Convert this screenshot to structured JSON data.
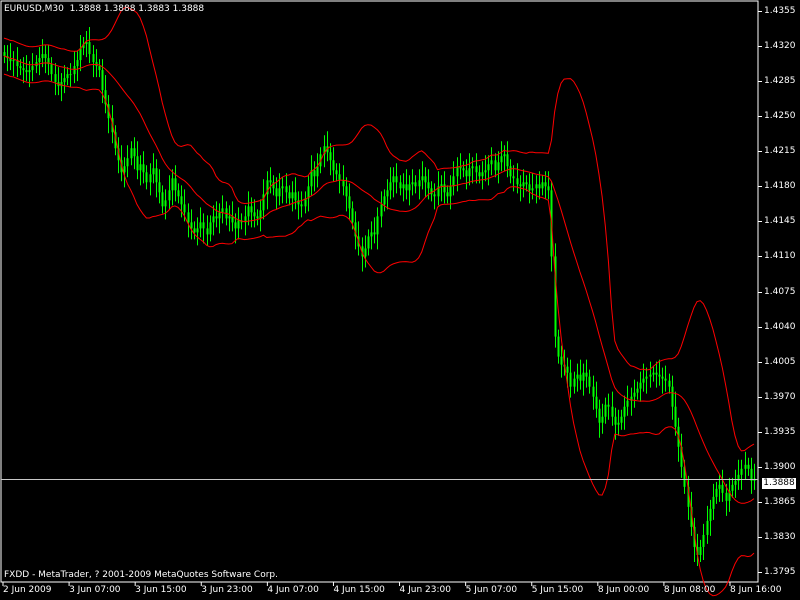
{
  "header": {
    "symbol": "EURUSD,M30",
    "ohlc": "1.3888 1.3888 1.3883 1.3888"
  },
  "footer": {
    "copyright": "FXDD - MetaTrader, ? 2001-2009 MetaQuotes Software Corp."
  },
  "current_price": "1.3888",
  "colors": {
    "background": "#000000",
    "candles": "#00FF00",
    "bands": "#FF0000",
    "axis": "#FFFFFF"
  },
  "chart_data": {
    "type": "candlestick",
    "indicator": "Bollinger Bands",
    "ylim": [
      1.3785,
      1.4365
    ],
    "x_tick_labels": [
      "2 Jun 2009",
      "3 Jun 07:00",
      "3 Jun 15:00",
      "3 Jun 23:00",
      "4 Jun 07:00",
      "4 Jun 15:00",
      "4 Jun 23:00",
      "5 Jun 07:00",
      "5 Jun 15:00",
      "8 Jun 00:00",
      "8 Jun 08:00",
      "8 Jun 16:00"
    ],
    "y_tick_labels": [
      "1.4355",
      "1.4320",
      "1.4285",
      "1.4250",
      "1.4215",
      "1.4180",
      "1.4145",
      "1.4110",
      "1.4075",
      "1.4040",
      "1.4005",
      "1.3970",
      "1.3935",
      "1.3900",
      "1.3865",
      "1.3830",
      "1.3795"
    ],
    "y_ticks": [
      1.4355,
      1.432,
      1.4285,
      1.425,
      1.4215,
      1.418,
      1.4145,
      1.411,
      1.4075,
      1.404,
      1.4005,
      1.397,
      1.3935,
      1.39,
      1.3865,
      1.383,
      1.3795
    ],
    "current_price": 1.3888,
    "close": [
      1.431,
      1.4308,
      1.4305,
      1.4306,
      1.43,
      1.4298,
      1.4296,
      1.4294,
      1.4296,
      1.43,
      1.4304,
      1.4308,
      1.4312,
      1.4308,
      1.4302,
      1.4292,
      1.4284,
      1.428,
      1.4284,
      1.4288,
      1.4292,
      1.4292,
      1.43,
      1.4306,
      1.4318,
      1.4322,
      1.4324,
      1.4312,
      1.4304,
      1.43,
      1.4296,
      1.4276,
      1.4262,
      1.4248,
      1.4234,
      1.4218,
      1.4206,
      1.4194,
      1.42,
      1.4208,
      1.4218,
      1.421,
      1.4196,
      1.4202,
      1.4194,
      1.4184,
      1.4192,
      1.4198,
      1.4184,
      1.4174,
      1.416,
      1.4166,
      1.4176,
      1.4188,
      1.4176,
      1.417,
      1.4162,
      1.4154,
      1.4144,
      1.4138,
      1.4134,
      1.4138,
      1.4144,
      1.4138,
      1.4132,
      1.4144,
      1.415,
      1.4148,
      1.4154,
      1.4158,
      1.4148,
      1.415,
      1.4144,
      1.4138,
      1.4146,
      1.4144,
      1.415,
      1.416,
      1.4154,
      1.415,
      1.4148,
      1.4156,
      1.4172,
      1.4186,
      1.4184,
      1.4178,
      1.417,
      1.4178,
      1.418,
      1.4174,
      1.4168,
      1.4174,
      1.4166,
      1.4162,
      1.416,
      1.4168,
      1.418,
      1.4196,
      1.419,
      1.42,
      1.4212,
      1.422,
      1.4214,
      1.4206,
      1.4196,
      1.4192,
      1.4186,
      1.418,
      1.417,
      1.4158,
      1.4144,
      1.413,
      1.412,
      1.411,
      1.4118,
      1.413,
      1.4134,
      1.4132,
      1.415,
      1.4162,
      1.417,
      1.4176,
      1.4184,
      1.419,
      1.4184,
      1.4178,
      1.4182,
      1.4176,
      1.4182,
      1.4184,
      1.418,
      1.4186,
      1.419,
      1.4184,
      1.4178,
      1.4172,
      1.417,
      1.418,
      1.4182,
      1.4174,
      1.417,
      1.418,
      1.419,
      1.42,
      1.4198,
      1.4196,
      1.419,
      1.4198,
      1.42,
      1.4194,
      1.419,
      1.4194,
      1.4196,
      1.4202,
      1.4206,
      1.4196,
      1.4204,
      1.421,
      1.4212,
      1.42,
      1.419,
      1.4188,
      1.4182,
      1.418,
      1.4184,
      1.4182,
      1.4176,
      1.4178,
      1.4182,
      1.4178,
      1.4184,
      1.418,
      1.4176,
      1.411,
      1.403,
      1.401,
      1.4002,
      1.4,
      1.3994,
      1.398,
      1.3988,
      1.3992,
      1.3986,
      1.3994,
      1.399,
      1.398,
      1.397,
      1.3958,
      1.3944,
      1.395,
      1.3962,
      1.396,
      1.395,
      1.3942,
      1.3944,
      1.395,
      1.396,
      1.3966,
      1.397,
      1.3974,
      1.3978,
      1.3984,
      1.3988,
      1.399,
      1.3992,
      1.3994,
      1.3992,
      1.399,
      1.3988,
      1.3986,
      1.398,
      1.396,
      1.394,
      1.392,
      1.39,
      1.388,
      1.386,
      1.384,
      1.382,
      1.3812,
      1.382,
      1.3832,
      1.3846,
      1.3858,
      1.387,
      1.3878,
      1.3882,
      1.3874,
      1.3866,
      1.3876,
      1.3882,
      1.3886,
      1.3892,
      1.3898,
      1.3902,
      1.3898,
      1.3886,
      1.3888
    ]
  }
}
